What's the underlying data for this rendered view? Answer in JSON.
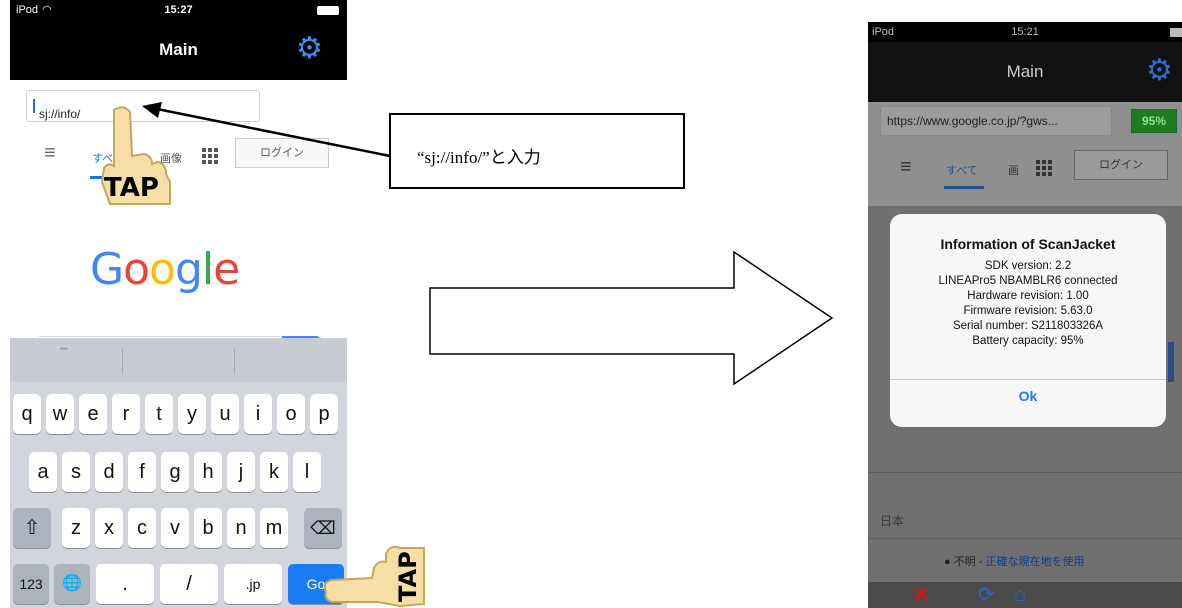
{
  "left_phone": {
    "status": {
      "carrier": "iPod",
      "time": "15:27"
    },
    "nav_title": "Main",
    "url_value": "sj://info/",
    "google_tabs": {
      "all": "すべ",
      "images": "画像",
      "login": "ログイン"
    },
    "logo_letters": [
      "G",
      "o",
      "o",
      "g",
      "l",
      "e"
    ],
    "keyboard": {
      "suggestion": "\"\"",
      "row1": [
        "q",
        "w",
        "e",
        "r",
        "t",
        "y",
        "u",
        "i",
        "o",
        "p"
      ],
      "row2": [
        "a",
        "s",
        "d",
        "f",
        "g",
        "h",
        "j",
        "k",
        "l"
      ],
      "row3": [
        "z",
        "x",
        "c",
        "v",
        "b",
        "n",
        "m"
      ],
      "shift": "⇧",
      "backspace": "⌫",
      "numbers": "123",
      "globe": "🌐",
      "dot": ".",
      "slash": "/",
      "jp": ".jp",
      "go": "Go"
    },
    "tap_label": "TAP"
  },
  "callout": {
    "text": "“sj://info/”と入力"
  },
  "right_phone": {
    "status": {
      "carrier": "iPod",
      "time": "15:21"
    },
    "nav_title": "Main",
    "url_value": "https://www.google.co.jp/?gws...",
    "battery_badge": "95%",
    "google_tabs": {
      "all": "すべて",
      "images": "画",
      "login": "ログイン"
    },
    "dialog": {
      "title": "Information of ScanJacket",
      "lines": [
        "SDK version: 2.2",
        "LINEAPro5 NBAMBLR6 connected",
        "Hardware revision: 1.00",
        "Firmware revision: 5.63.0",
        "Serial number: S211803326A",
        "Battery capacity: 95%"
      ],
      "ok": "Ok"
    },
    "region": "日本",
    "location": {
      "prefix": "● 不明 - ",
      "link": "正確な現在地を使用"
    }
  },
  "colors": {
    "accent_blue": "#1a7cf5",
    "gear_blue": "#3b8ff0",
    "battery_green": "#207a20"
  }
}
